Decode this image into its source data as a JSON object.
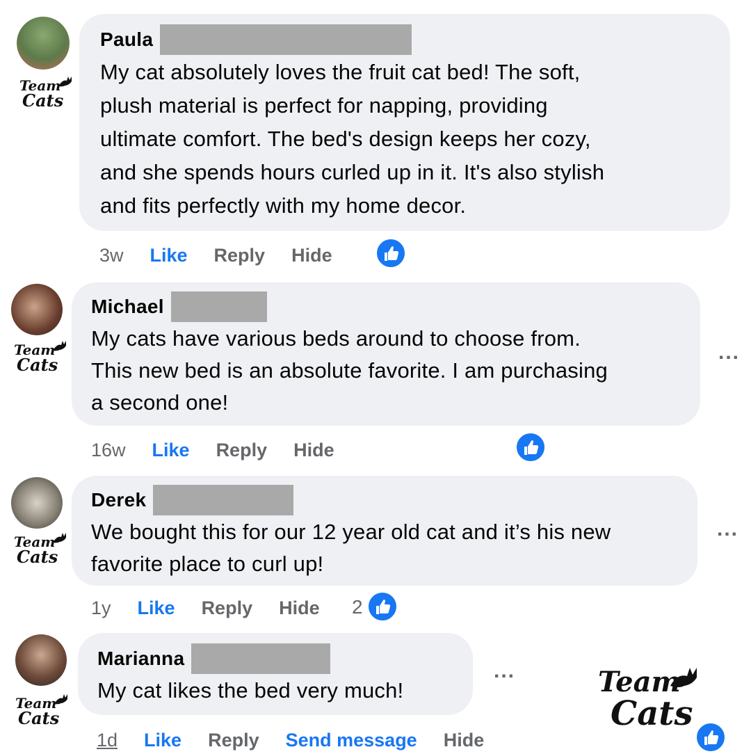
{
  "brand": {
    "logo_text": "Team Cats",
    "accent": "#1877f2",
    "bubble_bg": "#eff0f3",
    "meta_color": "#65676b"
  },
  "comments": [
    {
      "name": "Paula",
      "text": "My cat absolutely loves the fruit cat bed! The soft,\nplush material is perfect for napping, providing\nultimate comfort. The bed's design keeps her cozy,\nand she spends hours curled up in it. It's also stylish\nand fits perfectly with my home decor.",
      "time": "3w",
      "like": "Like",
      "reply": "Reply",
      "hide": "Hide",
      "reaction_icon": "thumbs-up-icon"
    },
    {
      "name": "Michael",
      "text": "My cats have various beds around to choose from.\nThis new bed is an absolute favorite. I am purchasing\na second one!",
      "time": "16w",
      "like": "Like",
      "reply": "Reply",
      "hide": "Hide",
      "more": "...",
      "reaction_icon": "thumbs-up-icon"
    },
    {
      "name": "Derek",
      "text": "We bought this for our 12 year old cat and it’s his new\nfavorite place to curl up!",
      "time": "1y",
      "like": "Like",
      "reply": "Reply",
      "hide": "Hide",
      "more": "...",
      "reaction_count": "2",
      "reaction_icon": "thumbs-up-icon"
    },
    {
      "name": "Marianna",
      "text": "My cat likes the bed very much!",
      "time": "1d",
      "like": "Like",
      "reply": "Reply",
      "send": "Send message",
      "hide": "Hide",
      "more": "...",
      "reaction_icon": "thumbs-up-icon"
    }
  ]
}
